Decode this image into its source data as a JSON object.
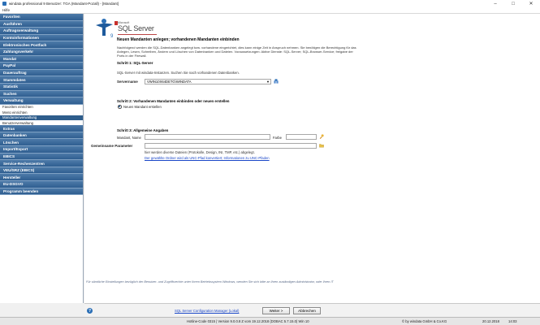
{
  "window": {
    "title": "windata professional 9 Benutzer: TGA (Mandant-Pozall) - [Mandant]",
    "controls": {
      "minimize": "–",
      "maximize": "□",
      "close": "✕"
    }
  },
  "menu": {
    "items": [
      "Hilfe"
    ]
  },
  "sidebar": {
    "groups_top": [
      "Favoriten",
      "Ausführen",
      "Auftragsverwaltung",
      "Kontoinformationen",
      "Elektronisches Postfach",
      "Zahlungsverkehr",
      "Mandat",
      "PayPal",
      "Dauerauftrag",
      "Stammdaten",
      "Statistik",
      "Suchen",
      "Verwaltung"
    ],
    "sub_items": [
      {
        "label": "Favoriten einrichten",
        "active": false
      },
      {
        "label": "Menü einrichten",
        "active": false
      },
      {
        "label": "Mandantenverwaltung",
        "active": true
      },
      {
        "label": "Benutzerverwaltung",
        "active": false
      }
    ],
    "groups_bottom": [
      "Extras",
      "Datenbanken",
      "Löschen",
      "Import/Export",
      "EBICS",
      "Service-Rechenzentren",
      "VEU/SRZ (EBICS)",
      "Hersteller",
      "EU-DSGVO",
      "Programm beenden"
    ]
  },
  "main": {
    "logo_alt": "9",
    "sql_brand_small": "Microsoft",
    "sql_brand": "SQL Server",
    "heading": "Neuen Mandanten anlegen; vorhandenen Mandanten einbinden",
    "intro": "Nachfolgend werden die SQL-Datenbanken angelegt bzw. vorhandene eingerichtet, dies kann einige Zeit in Anspruch nehmen. Sie benötigen die Berechtigung für das Anlegen, Lesen, Schreiben, Ändern und Löschen von Datenbanken und Dateien. Voraussetzungen: Aktive Dienste: SQL-Server; SQL-Browser-Service; freigabe der Ports in der Firewall.",
    "step1": {
      "title": "Schritt 1: SQL-Server",
      "desc": "SQL-Server mit windata-Instanzen. Suchen Sie nach vorhandenen Datenbanken.",
      "server_label": "Servername",
      "server_value": "VWIN10X64DETG\\WINDATA"
    },
    "step2": {
      "title": "Schritt 2: Vorhandenen Mandanten einbinden oder neuen erstellen",
      "radio_label": "Neuen Mandant erstellen"
    },
    "step3": {
      "title": "Schritt 3: Allgemeine Angaben",
      "name_label": "Mandant, Name",
      "name_value": "",
      "color_label": "Farbe",
      "color_value": "",
      "param_label": "Gemeinsame Parameter",
      "param_value": "",
      "param_hint": "hier werden diverse Dateien (Protokolle, Design, INI, TMP, etc.) abgelegt.",
      "link": "Der gewählte Ordner wird als UNC-Pfad konvertiert; Informationen zu UNC-Pfaden"
    },
    "note": "Für sämtliche Einstellungen bezüglich der Benutzer- und Zugriffsrechte unter Ihrem Betriebssystem Windows, wenden Sie sich bitte an Ihren zuständigen Administrator, oder Ihren IT"
  },
  "footer": {
    "help": "?",
    "config_link": "SQL Server Configuration Manager (Lokal)",
    "next_button": "Weiter >",
    "cancel_button": "Abbrechen"
  },
  "status": {
    "hotline": "Hotline-Code 0315 | Version 9.0.0.8 Z vom 19.12.2018 (DOBAC 5.7.15.0) Win 10",
    "copyright": "© by windata GmbH & Co.KG",
    "date": "20.12.2018",
    "time": "14:03"
  },
  "colors": {
    "sidebar_header": "#2f5e90",
    "sidebar_active": "#2e5d8c",
    "link": "#1a47c8",
    "logo_blue": "#2b6fb6"
  }
}
